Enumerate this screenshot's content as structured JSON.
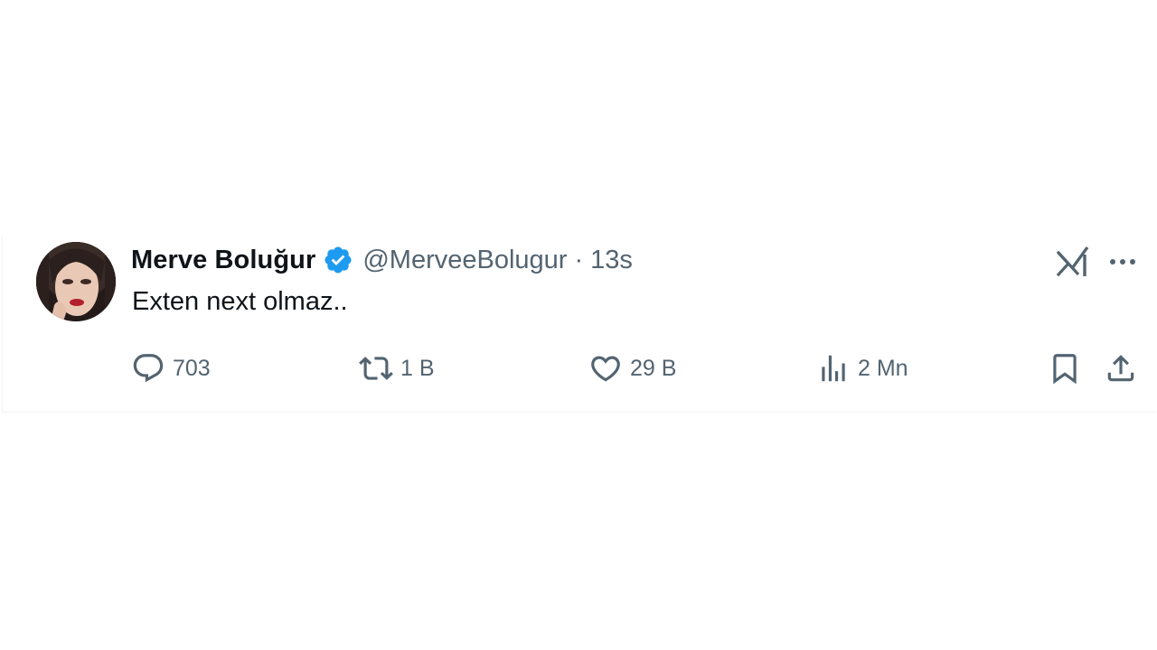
{
  "tweet": {
    "display_name": "Merve Boluğur",
    "verified": true,
    "handle": "@MerveeBolugur",
    "separator": "·",
    "time": "13s",
    "text": "Exten next olmaz..",
    "actions": {
      "replies": "703",
      "retweets": "1 B",
      "likes": "29 B",
      "views": "2 Mn"
    }
  },
  "icons": {
    "verified": "verified-badge-icon",
    "grok": "grok-icon",
    "more": "more-dots-icon",
    "reply": "reply-icon",
    "retweet": "retweet-icon",
    "like": "heart-icon",
    "views": "views-chart-icon",
    "bookmark": "bookmark-icon",
    "share": "share-icon"
  },
  "colors": {
    "verified_blue": "#1d9bf0",
    "text_primary": "#0f1419",
    "text_secondary": "#536471"
  }
}
